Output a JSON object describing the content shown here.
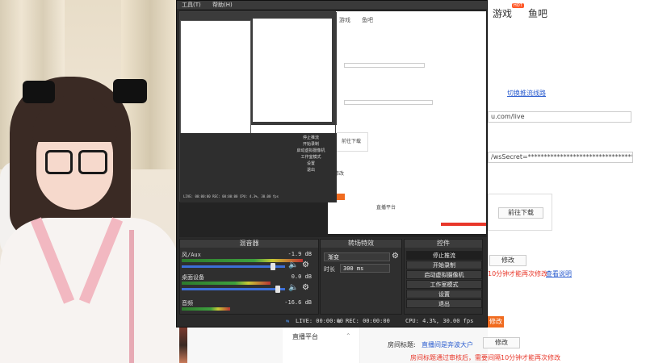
{
  "obs": {
    "menu": [
      "工具(T)",
      "帮助(H)"
    ],
    "mixer": {
      "title": "混音器",
      "channels": [
        {
          "label": "风/Aux",
          "db": "-1.9 dB"
        },
        {
          "label": "桌面设备",
          "db": "0.0 dB"
        },
        {
          "label": "音频",
          "db": "-16.6 dB"
        }
      ]
    },
    "transition": {
      "title": "转场特效",
      "selected": "渐变",
      "duration_label": "时长",
      "duration_value": "300 ms"
    },
    "controls": {
      "title": "控件",
      "buttons": [
        "停止推流",
        "开始录制",
        "启动虚拟摄像机",
        "工作室模式",
        "设置",
        "退出"
      ]
    },
    "status": {
      "live": "LIVE: 00:00:00",
      "rec": "REC: 00:00:00",
      "cpu": "CPU: 4.3%, 30.00 fps"
    }
  },
  "web": {
    "nav": {
      "game": "游戏",
      "fishbar": "鱼吧",
      "hot": "HOT"
    },
    "switch_line_link": "切换推流线路",
    "rtmp_url_tail": "u.com/live",
    "stream_key_tail": "/wsSecret=**********************************&wi",
    "download_button": "前往下载",
    "modify_button_1": "修改",
    "notice_red_1": "10分钟才能再次修改",
    "view_notice_link": "查看说明",
    "modify_label": "修改",
    "room_title_label": "房间标题:",
    "room_title_value": "直播间是奔波大户",
    "modify_button_2": "修改",
    "notice_red_2": "房间标题通过审核后，需要间隔10分钟才能再次修改",
    "side_menu_item": "直播平台"
  },
  "preview": {
    "nested_tabs": [
      "游戏",
      "鱼吧"
    ],
    "nested_controls": [
      "停止推流",
      "开始录制",
      "启动虚拟摄像机",
      "工作室模式",
      "设置",
      "退出"
    ],
    "nested_status": "LIVE: 00:00:00  REC: 00:00:00  CPU: 4.3%, 30.00 fps",
    "page_labels": [
      "前往下载",
      "修改",
      "直播平台"
    ]
  },
  "colors": {
    "obs_bg": "#2b2b2b",
    "accent_blue": "#3c6fd8",
    "link_blue": "#2a5ccf",
    "warning_red": "#e8372a",
    "hot_orange": "#ff5a2a"
  }
}
